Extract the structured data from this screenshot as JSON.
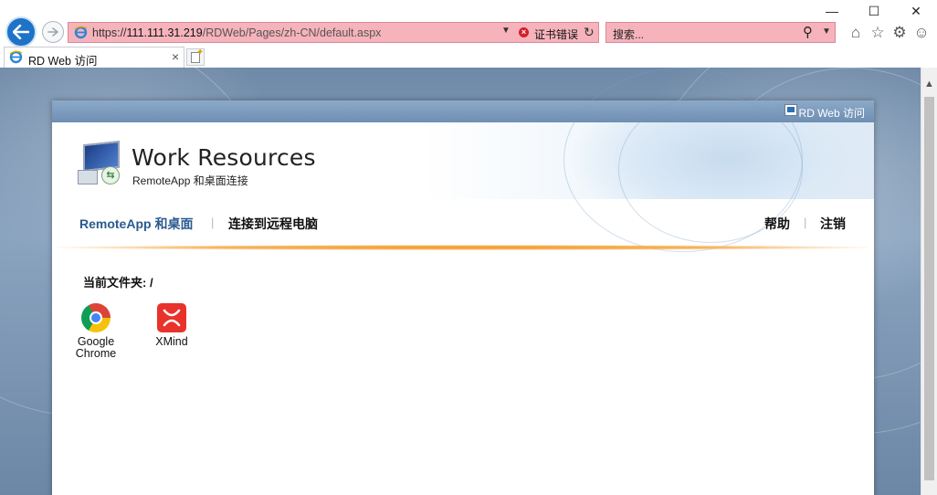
{
  "window": {
    "minimize": "—",
    "maximize": "☐",
    "close": "✕"
  },
  "address_bar": {
    "scheme": "https://",
    "host": "111.111.31.219",
    "path": "/RDWeb/Pages/zh-CN/default.aspx",
    "cert_error": "证书错误"
  },
  "search": {
    "placeholder": "搜索..."
  },
  "tab": {
    "title": "RD Web 访问"
  },
  "page": {
    "top_link": "RD Web 访问",
    "title": "Work Resources",
    "subtitle": "RemoteApp 和桌面连接",
    "nav": {
      "remoteapp": "RemoteApp 和桌面",
      "connect_remote": "连接到远程电脑",
      "help": "帮助",
      "logout": "注销"
    },
    "current_folder": "当前文件夹: /",
    "apps": [
      {
        "name_line1": "Google",
        "name_line2": "Chrome",
        "icon": "chrome-icon"
      },
      {
        "name_line1": "XMind",
        "name_line2": "",
        "icon": "xmind-icon"
      }
    ]
  },
  "colors": {
    "address_bar_error": "#f6b3bc",
    "nav_active": "#2a5a8e",
    "accent_line": "#f39a24",
    "back_button": "#1e73c8"
  }
}
